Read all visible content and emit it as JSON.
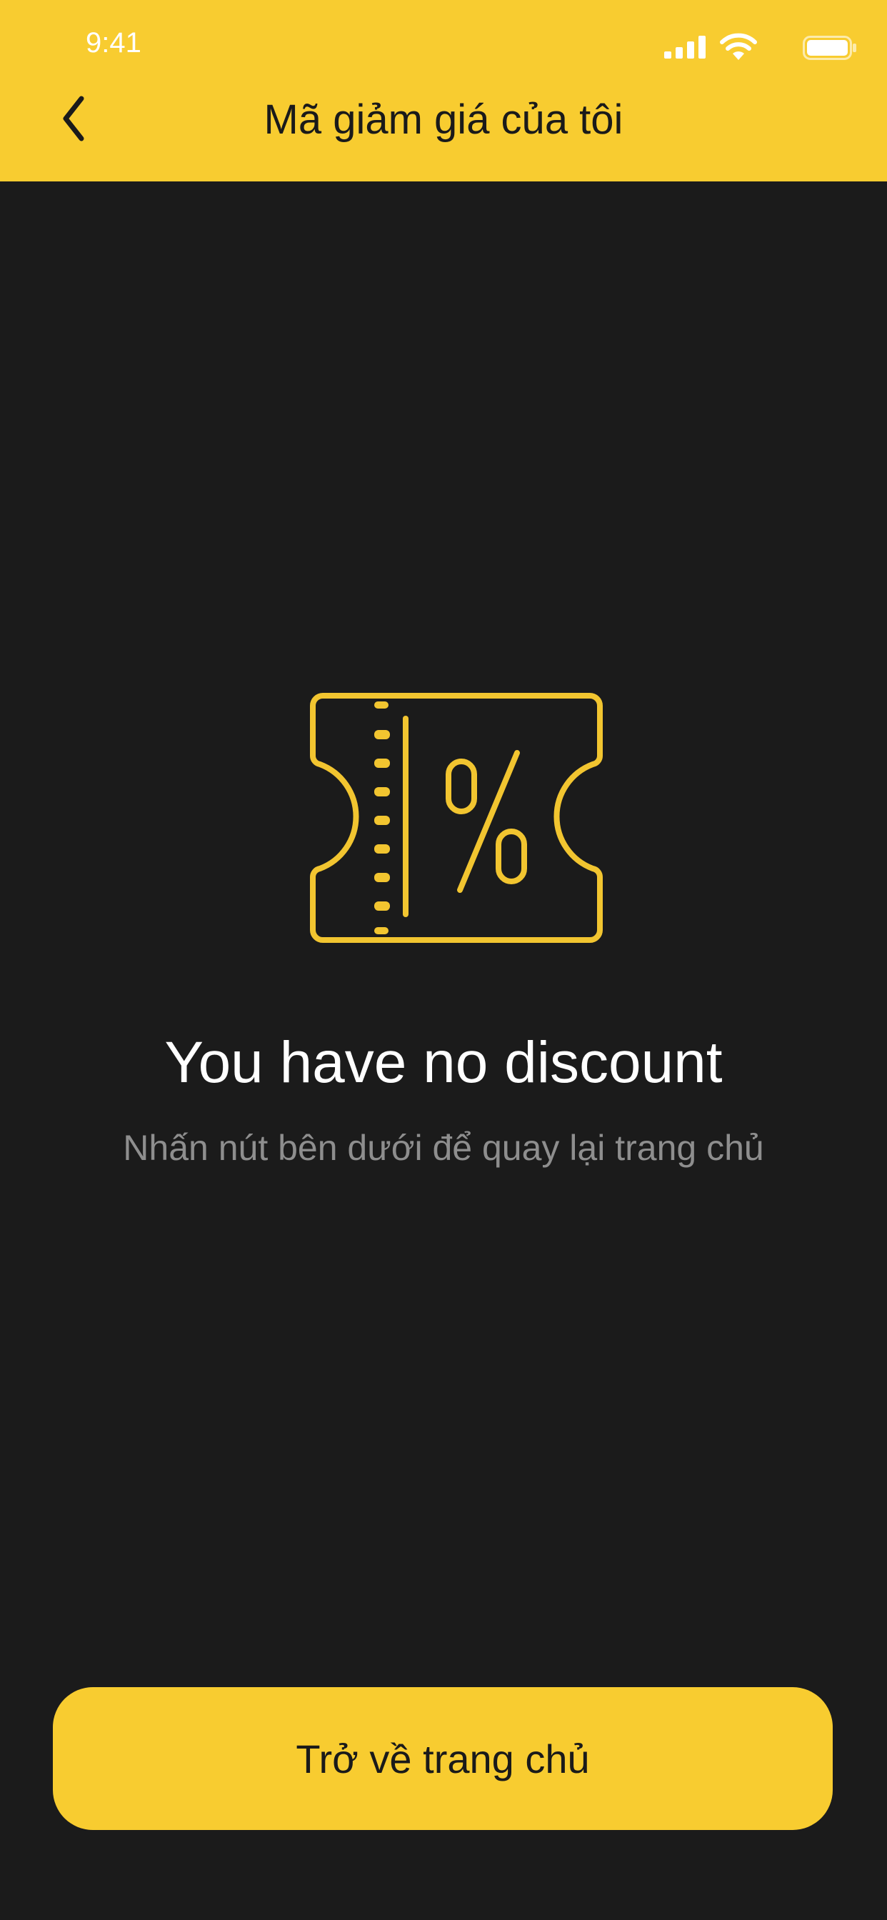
{
  "status_bar": {
    "time": "9:41",
    "icons": [
      "signal-icon",
      "wifi-icon",
      "battery-icon"
    ]
  },
  "header": {
    "title": "Mã giảm giá của tôi",
    "back_icon": "chevron-left-icon",
    "background": "#f8cc30"
  },
  "empty_state": {
    "icon": "coupon-percent-icon",
    "title": "You have no discount",
    "subtitle": "Nhấn nút bên dưới để quay lại trang chủ"
  },
  "footer": {
    "home_button_label": "Trở về trang chủ"
  },
  "colors": {
    "accent": "#f8cc30",
    "background": "#1b1b1b",
    "title_text": "#ffffff",
    "subtitle_text": "#8e8e8e"
  }
}
